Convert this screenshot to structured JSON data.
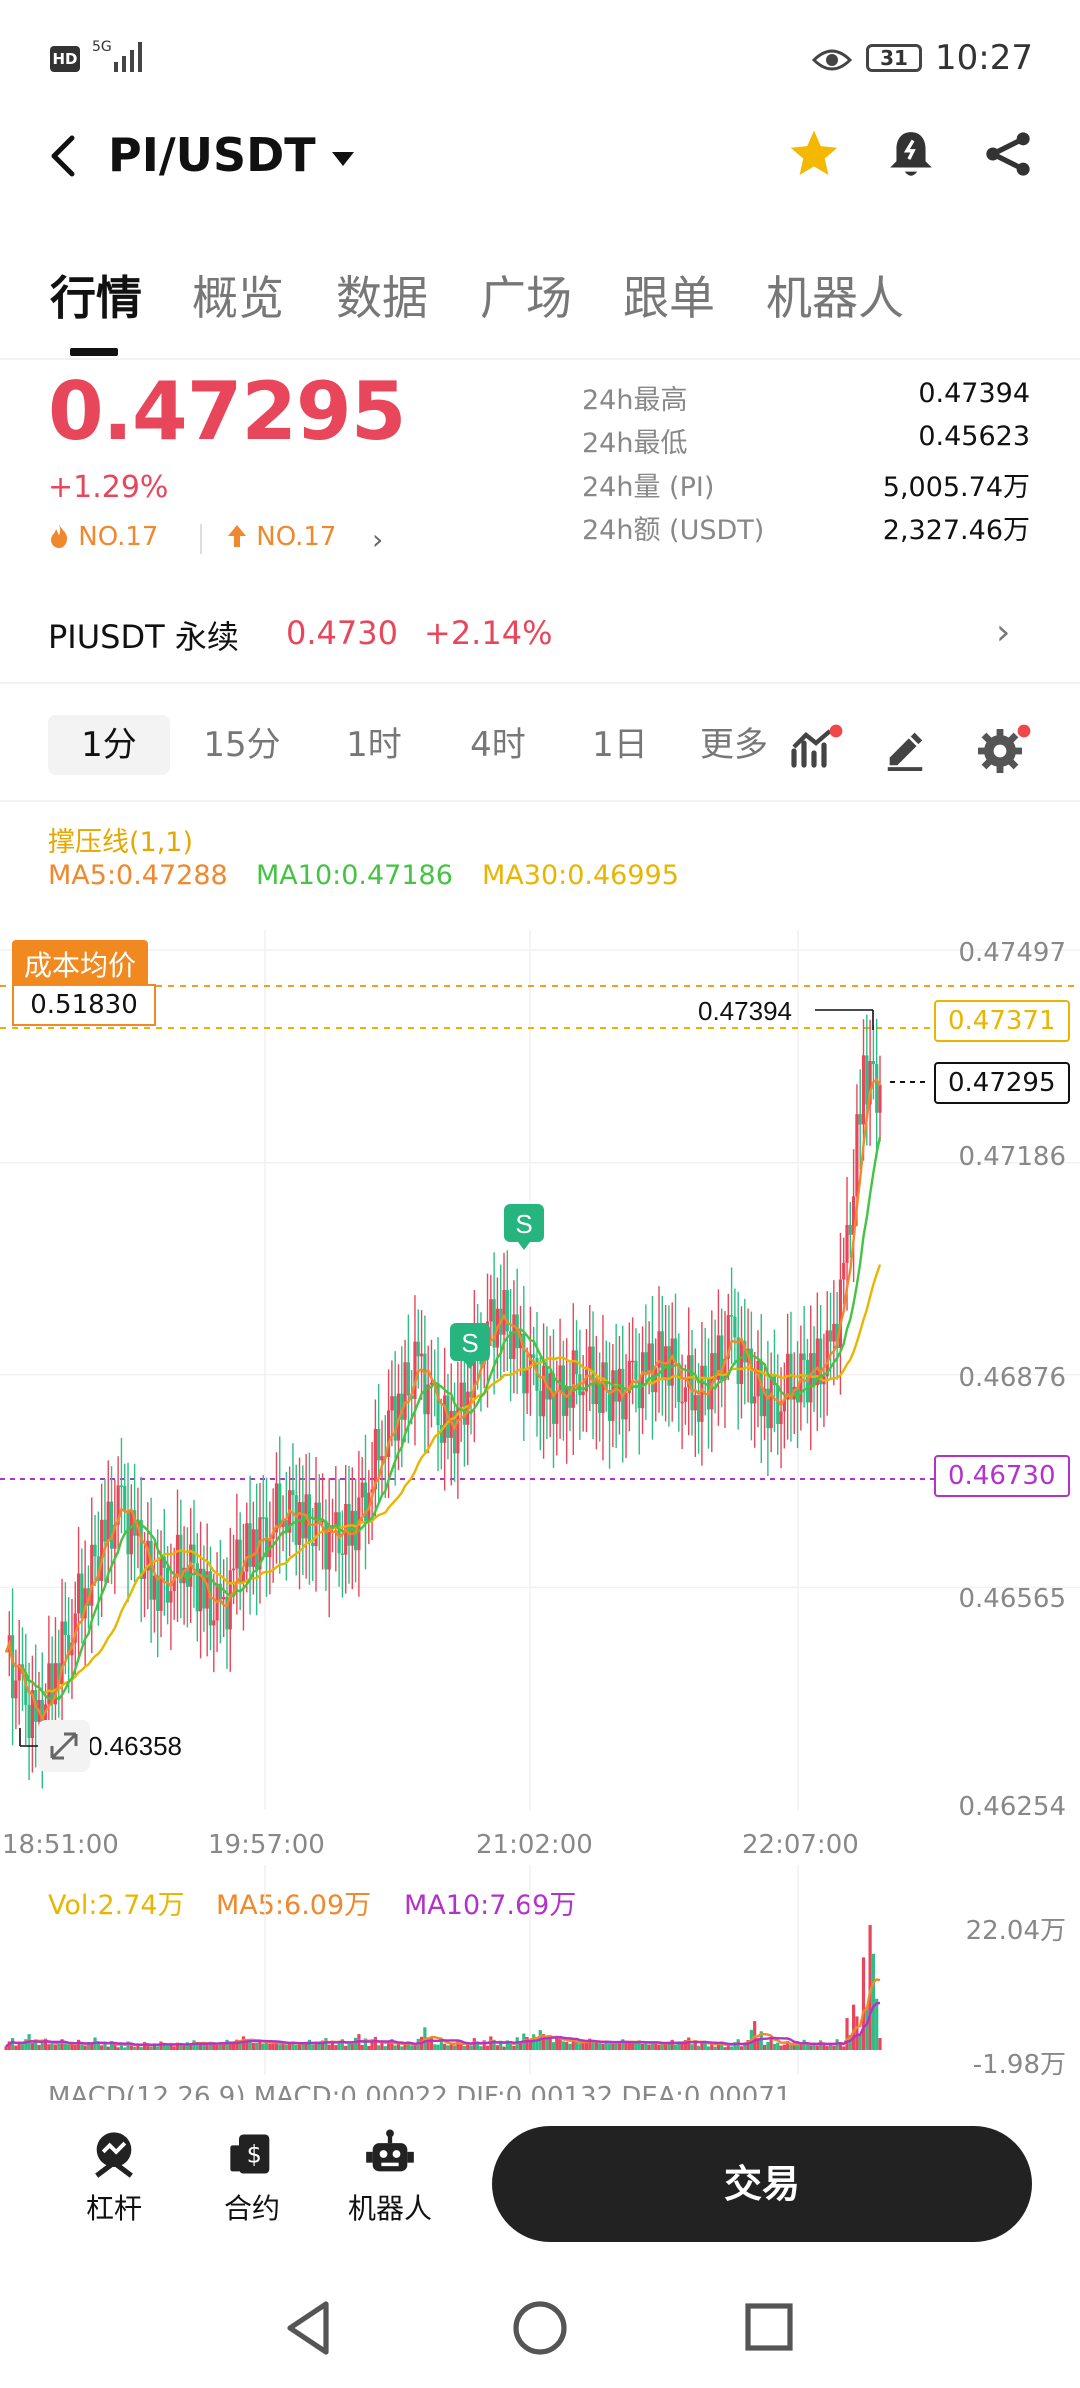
{
  "status_bar": {
    "hd": "HD",
    "signal": "5G",
    "battery": "31",
    "time": "10:27"
  },
  "header": {
    "pair": "PI/USDT",
    "icons": [
      "back-icon",
      "dropdown-caret-icon",
      "star-icon",
      "bell-icon",
      "share-icon"
    ],
    "star_color": "#f5b800"
  },
  "tabs": [
    "行情",
    "概览",
    "数据",
    "广场",
    "跟单",
    "机器人"
  ],
  "ticker": {
    "price": "0.47295",
    "change": "+1.29%",
    "rank_hot": "NO.17",
    "rank_up": "NO.17",
    "stats": [
      {
        "label": "24h最高",
        "value": "0.47394"
      },
      {
        "label": "24h最低",
        "value": "0.45623"
      },
      {
        "label": "24h量 (PI)",
        "value": "5,005.74万"
      },
      {
        "label": "24h额 (USDT)",
        "value": "2,327.46万"
      }
    ],
    "up_color": "#e8465a",
    "down_color": "#2fbd85"
  },
  "perpetual": {
    "name": "PIUSDT 永续",
    "price": "0.4730",
    "change": "+2.14%"
  },
  "intervals": [
    "1分",
    "15分",
    "1时",
    "4时",
    "1日",
    "更多"
  ],
  "toolbar_icons": [
    "indicator-icon",
    "draw-icon",
    "settings-icon"
  ],
  "chart": {
    "support_label": "撑压线(1,1)",
    "ma5": "MA5:0.47288",
    "ma10": "MA10:0.47186",
    "ma30": "MA30:0.46995",
    "cost_tag": "成本均价",
    "cost_value": "0.51830",
    "high_label": "0.47394",
    "low_label": "0.46358",
    "y_labels": [
      "0.47497",
      "0.47186",
      "0.46876",
      "0.46565",
      "0.46254"
    ],
    "box_ma": "0.47371",
    "box_last": "0.47295",
    "box_line": "0.46730",
    "signal_mark": "S",
    "x_labels": [
      "18:51:00",
      "19:57:00",
      "21:02:00",
      "22:07:00"
    ],
    "vol": "Vol:2.74万",
    "vol_ma5": "MA5:6.09万",
    "vol_ma10": "MA10:7.69万",
    "vol_top": "22.04万",
    "vol_bottom": "-1.98万",
    "macd": "MACD(12,26,9)  MACD:0.00022  DIF:0.00132  DEA:0.00071",
    "ma5_color": "#f0882d",
    "ma10_color": "#44c443",
    "ma30_color": "#e8b500",
    "vol_ma10_color": "#b133c9"
  },
  "chart_data": {
    "type": "candlestick",
    "ylim": [
      0.46254,
      0.47497
    ],
    "y_ticks": [
      0.47497,
      0.47186,
      0.46876,
      0.46565,
      0.46254
    ],
    "x_ticks": [
      "18:51:00",
      "19:57:00",
      "21:02:00",
      "22:07:00"
    ],
    "close_series": [
      0.4647,
      0.464,
      0.4636,
      0.4645,
      0.4652,
      0.4658,
      0.4664,
      0.4668,
      0.4662,
      0.4657,
      0.4659,
      0.4661,
      0.4655,
      0.4652,
      0.4659,
      0.4663,
      0.4666,
      0.4669,
      0.4666,
      0.4664,
      0.4663,
      0.4665,
      0.4672,
      0.468,
      0.4684,
      0.4689,
      0.4682,
      0.4679,
      0.4686,
      0.4694,
      0.4697,
      0.4691,
      0.4686,
      0.4684,
      0.4686,
      0.4689,
      0.4686,
      0.4684,
      0.4686,
      0.4688,
      0.4691,
      0.4687,
      0.4685,
      0.4688,
      0.4693,
      0.4687,
      0.4684,
      0.4685,
      0.4688,
      0.4688,
      0.469,
      0.4705,
      0.4732,
      0.473
    ],
    "overlay_lines": [
      {
        "name": "MA5",
        "value": 0.47288
      },
      {
        "name": "MA10",
        "value": 0.47186
      },
      {
        "name": "MA30",
        "value": 0.46995
      }
    ],
    "vol_ylim": [
      -1.98,
      22.04
    ],
    "volume": [
      2.1,
      2.8,
      2.0,
      1.9,
      1.8,
      2.2,
      1.6,
      1.5,
      1.4,
      1.5,
      1.3,
      1.7,
      1.4,
      1.8,
      2.4,
      1.7,
      1.6,
      1.5,
      1.8,
      2.1,
      1.9,
      2.8,
      2.3,
      1.9,
      1.5,
      4.0,
      1.8,
      1.8,
      2.1,
      2.4,
      1.7,
      2.9,
      3.5,
      2.5,
      1.8,
      2.0,
      1.6,
      1.9,
      1.7,
      1.5,
      1.8,
      2.2,
      1.6,
      1.5,
      1.9,
      5.1,
      2.2,
      1.6,
      1.8,
      1.7,
      1.9,
      8.0,
      22.04,
      2.74
    ]
  },
  "bottom_bar": {
    "items": [
      {
        "label": "杠杆",
        "icon": "leverage-icon"
      },
      {
        "label": "合约",
        "icon": "contract-icon"
      },
      {
        "label": "机器人",
        "icon": "robot-icon"
      }
    ],
    "trade": "交易"
  },
  "nav_icons": [
    "nav-back-icon",
    "nav-home-icon",
    "nav-recent-icon"
  ]
}
